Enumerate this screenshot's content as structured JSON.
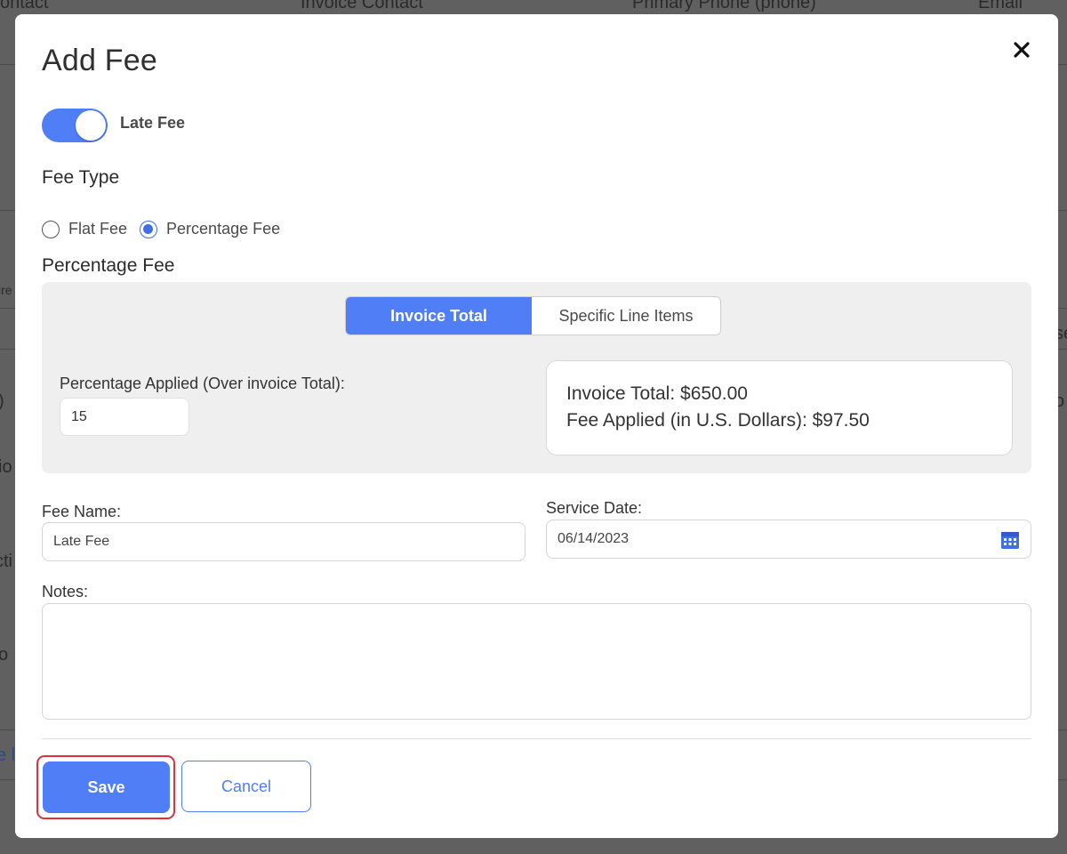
{
  "background": {
    "header_columns": [
      "ontact",
      "Invoice Contact",
      "Primary Phone (phone)",
      "Email"
    ],
    "fragments": [
      "ire",
      ")",
      "io",
      "cti",
      "o",
      "e l",
      "se",
      "o"
    ]
  },
  "modal": {
    "title": "Add Fee",
    "close_icon": "close-icon",
    "late_fee_toggle": {
      "label": "Late Fee",
      "on": true
    },
    "fee_type": {
      "heading": "Fee Type",
      "options": [
        {
          "label": "Flat Fee",
          "checked": false
        },
        {
          "label": "Percentage Fee",
          "checked": true
        }
      ]
    },
    "percentage_fee": {
      "heading": "Percentage Fee",
      "tabs": [
        {
          "label": "Invoice Total",
          "active": true
        },
        {
          "label": "Specific Line Items",
          "active": false
        }
      ],
      "applied_label": "Percentage Applied (Over invoice Total):",
      "applied_value": "15",
      "summary": {
        "invoice_total": "Invoice Total: $650.00",
        "fee_applied": "Fee Applied (in U.S. Dollars): $97.50"
      }
    },
    "fee_name": {
      "label": "Fee Name:",
      "value": "Late Fee"
    },
    "service_date": {
      "label": "Service Date:",
      "value": "06/14/2023",
      "icon": "calendar-icon"
    },
    "notes": {
      "label": "Notes:",
      "value": ""
    },
    "buttons": {
      "save": "Save",
      "cancel": "Cancel"
    },
    "colors": {
      "accent": "#4f7ef7",
      "highlight": "#e0303e"
    }
  }
}
